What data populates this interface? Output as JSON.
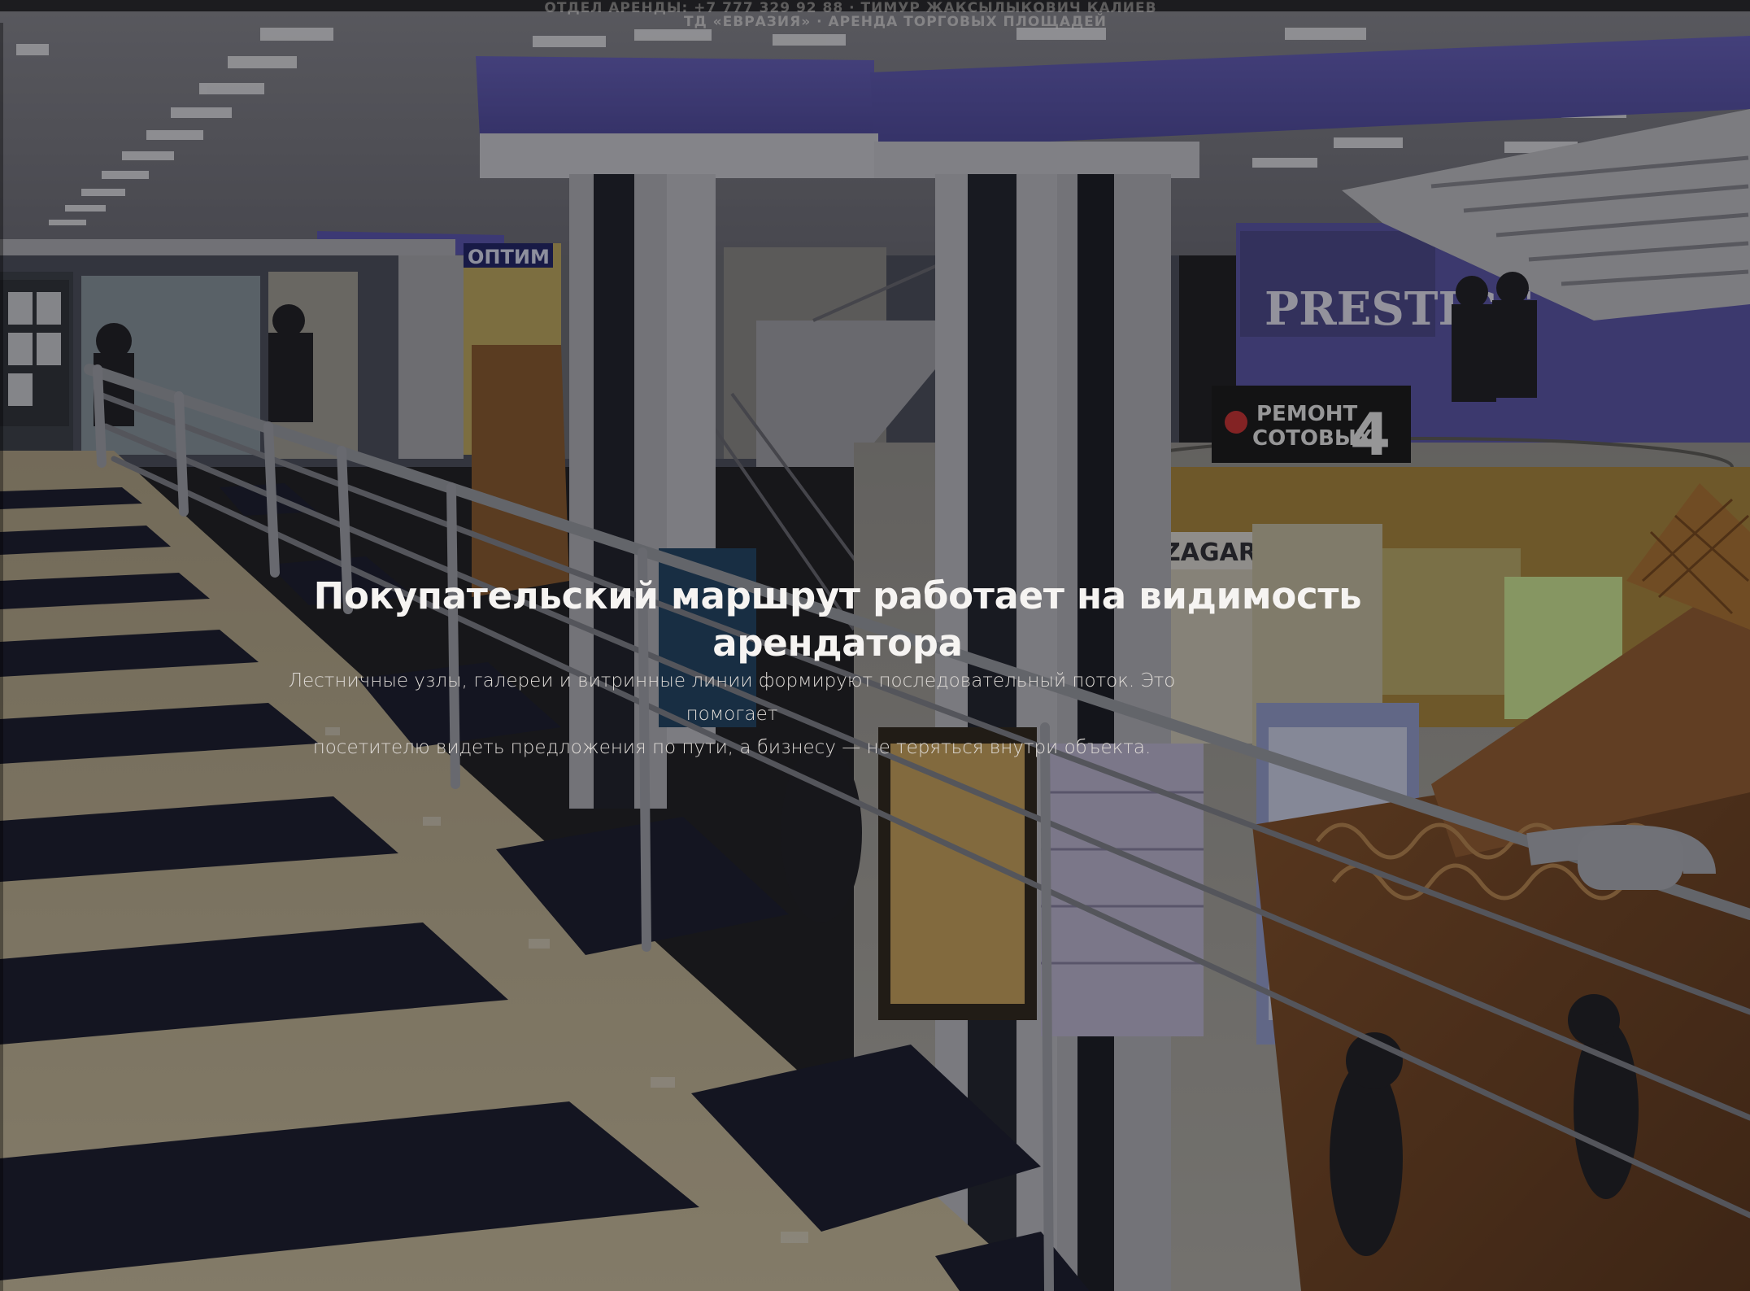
{
  "header": {
    "contact_line": "ОТДЕЛ АРЕНДЫ: +7 777 329 92 88 · ТИМУР ЖАКСЫЛЫКОВИЧ КАЛИЕВ",
    "tagline": "ТД «ЕВРАЗИЯ» · АРЕНДА ТОРГОВЫХ ПЛОЩАДЕЙ"
  },
  "hero": {
    "title": "Покупательский маршрут работает на видимость арендатора",
    "subtitle_line1": "Лестничные узлы, галереи и витринные линии формируют последовательный поток. Это помогает",
    "subtitle_line2": "посетителю видеть предложения по пути, а бизнесу — не теряться внутри объекта."
  },
  "photo": {
    "signs": {
      "prestige": "PRESTIGE",
      "repair_line1": "РЕМОНТ",
      "repair_line2": "СОТОВЫХ",
      "repair_number": "4",
      "zagarna": "ZAGARNA",
      "optimum": "ОПТИМ"
    }
  },
  "colors": {
    "overlay": "#121216",
    "ceiling_accent": "#5b55b8",
    "floor_light": "#cfc1a0",
    "floor_dark": "#15182a",
    "title_text": "#f6f4f2"
  }
}
